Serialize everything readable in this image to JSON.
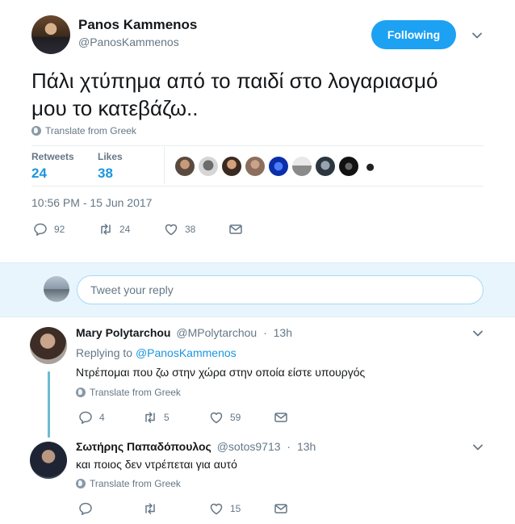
{
  "tweet": {
    "author_name": "Panos Kammenos",
    "author_handle": "@PanosKammenos",
    "follow_label": "Following",
    "text_line1": "Πάλι χτύπημα από το παιδί στο λογαριασμό",
    "text_line2": "μου το κατεβάζω..",
    "translate_label": "Translate from Greek",
    "retweets_label": "Retweets",
    "retweets_count": "24",
    "likes_label": "Likes",
    "likes_count": "38",
    "timestamp": "10:56 PM - 15 Jun 2017",
    "actions": {
      "replies": "92",
      "retweets": "24",
      "likes": "38"
    }
  },
  "reply_box": {
    "placeholder": "Tweet your reply"
  },
  "replies": [
    {
      "name": "Mary Polytarchou",
      "handle": "@MPolytarchou",
      "separator": "·",
      "time": "13h",
      "replying_prefix": "Replying to",
      "replying_to": "@PanosKammenos",
      "text": "Ντρέπομαι που ζω στην χώρα στην οποία είστε υπουργός",
      "translate_label": "Translate from Greek",
      "reply_count": "4",
      "retweet_count": "5",
      "like_count": "59"
    },
    {
      "name": "Σωτήρης Παπαδόπουλος",
      "handle": "@sotos9713",
      "separator": "·",
      "time": "13h",
      "text": "και ποιος δεν ντρέπεται για αυτό",
      "translate_label": "Translate from Greek",
      "reply_count": "",
      "retweet_count": "",
      "like_count": "15"
    }
  ],
  "colors": {
    "accent": "#1da1f2",
    "link": "#1b95e0",
    "muted": "#657786",
    "reply_bg": "#e8f5fd"
  }
}
